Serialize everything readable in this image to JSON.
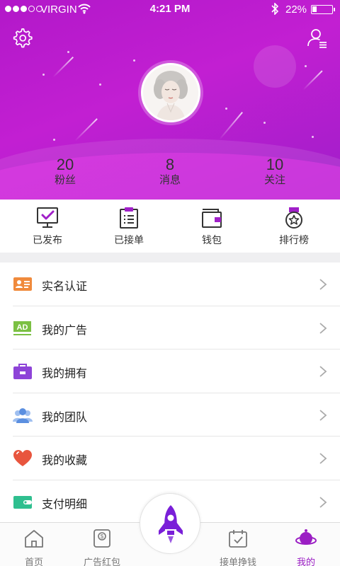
{
  "status_bar": {
    "carrier": "VIRGIN",
    "time": "4:21 PM",
    "battery": "22%",
    "battery_level": 0.22,
    "signal_bars": 3
  },
  "header": {
    "settings_icon": "gear-icon",
    "profile_icon": "profile-list-icon",
    "stats": [
      {
        "value": "20",
        "label": "粉丝"
      },
      {
        "value": "8",
        "label": "消息"
      },
      {
        "value": "10",
        "label": "关注"
      }
    ]
  },
  "quick_actions": [
    {
      "label": "已发布",
      "icon": "monitor-check-icon"
    },
    {
      "label": "已接单",
      "icon": "clipboard-list-icon"
    },
    {
      "label": "钱包",
      "icon": "wallet-icon"
    },
    {
      "label": "排行榜",
      "icon": "medal-icon"
    }
  ],
  "menu": [
    {
      "label": "实名认证",
      "icon": "id-card-icon",
      "color": "#f08a3c"
    },
    {
      "label": "我的广告",
      "icon": "ad-icon",
      "color": "#7bc043"
    },
    {
      "label": "我的拥有",
      "icon": "briefcase-icon",
      "color": "#8e44d8"
    },
    {
      "label": "我的团队",
      "icon": "team-icon",
      "color": "#6a9de8"
    },
    {
      "label": "我的收藏",
      "icon": "heart-icon",
      "color": "#e8553e"
    },
    {
      "label": "支付明细",
      "icon": "payment-card-icon",
      "color": "#2fbf8f"
    }
  ],
  "tab_bar": {
    "tabs": [
      {
        "label": "首页",
        "icon": "home-icon",
        "active": false
      },
      {
        "label": "广告红包",
        "icon": "red-envelope-icon",
        "active": false
      },
      {
        "label": "接单挣钱",
        "icon": "calendar-check-icon",
        "active": false
      },
      {
        "label": "我的",
        "icon": "planet-icon",
        "active": true
      }
    ],
    "center_icon": "rocket-icon"
  },
  "colors": {
    "brand_purple": "#b218c9",
    "active_tab": "#9b1ec4"
  }
}
